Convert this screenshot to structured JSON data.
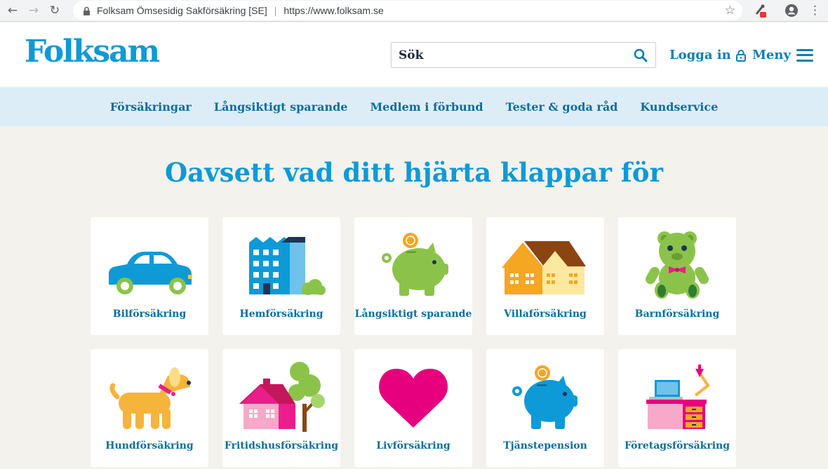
{
  "browser": {
    "site_name": "Folksam Ömsesidig Sakförsäkring [SE]",
    "url": "https://www.folksam.se"
  },
  "header": {
    "logo": "Folksam",
    "search_placeholder": "Sök",
    "login_label": "Logga in",
    "menu_label": "Meny"
  },
  "subnav": [
    "Försäkringar",
    "Långsiktigt sparande",
    "Medlem i förbund",
    "Tester & goda råd",
    "Kundservice"
  ],
  "main": {
    "headline": "Oavsett vad ditt hjärta klappar för",
    "cards": [
      {
        "label": "Bilförsäkring",
        "icon": "car-icon"
      },
      {
        "label": "Hemförsäkring",
        "icon": "apartment-building-icon"
      },
      {
        "label": "Långsiktigt sparande",
        "icon": "piggy-bank-icon"
      },
      {
        "label": "Villaförsäkring",
        "icon": "house-icon"
      },
      {
        "label": "Barnförsäkring",
        "icon": "teddy-bear-icon"
      },
      {
        "label": "Hundförsäkring",
        "icon": "dog-icon"
      },
      {
        "label": "Fritidshusförsäkring",
        "icon": "cottage-icon"
      },
      {
        "label": "Livförsäkring",
        "icon": "heart-icon"
      },
      {
        "label": "Tjänstepension",
        "icon": "pension-piggy-icon"
      },
      {
        "label": "Företagsförsäkring",
        "icon": "office-desk-icon"
      }
    ]
  },
  "colors": {
    "brand_blue": "#0d9ad7",
    "link_blue": "#0a6e9e",
    "subnav_bg": "#dcedf8",
    "page_bg": "#f4f2ec"
  }
}
